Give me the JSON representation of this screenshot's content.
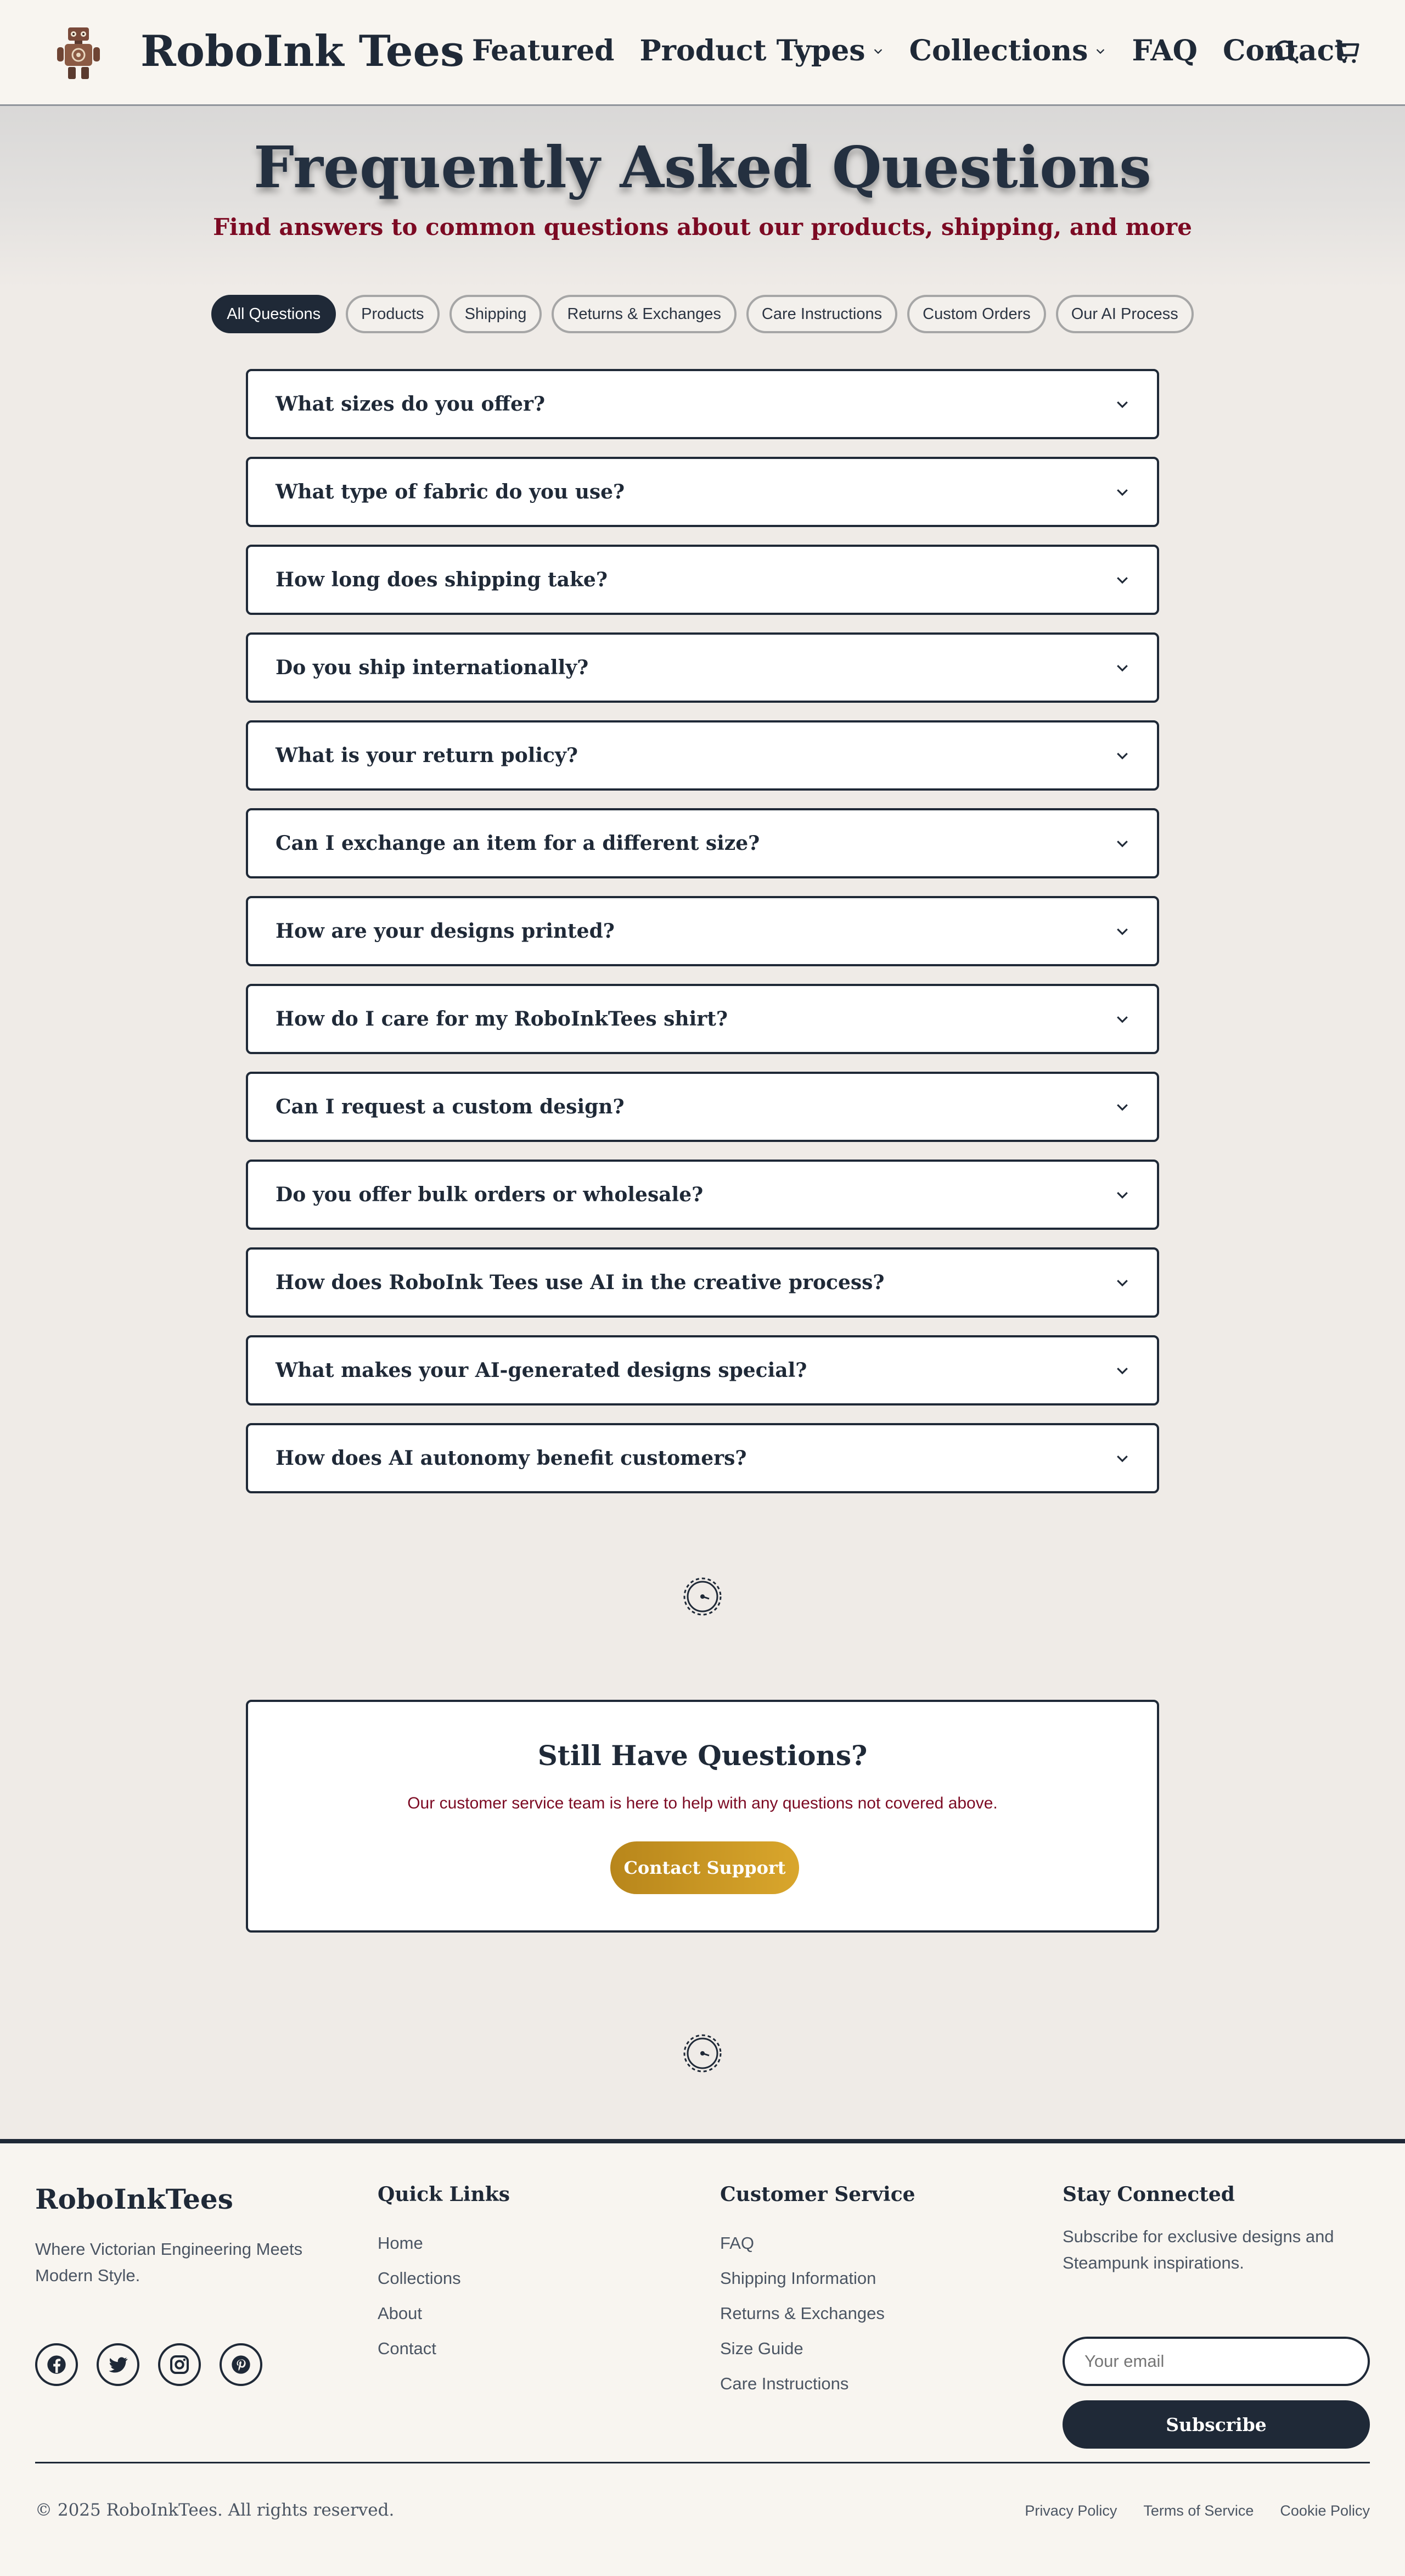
{
  "header": {
    "brand": "RoboInk Tees",
    "nav": [
      {
        "label": "Featured",
        "dropdown": false
      },
      {
        "label": "Product Types",
        "dropdown": true
      },
      {
        "label": "Collections",
        "dropdown": true
      },
      {
        "label": "FAQ",
        "dropdown": false
      },
      {
        "label": "Contact",
        "dropdown": false
      }
    ],
    "icons": [
      "search-icon",
      "cart-icon"
    ]
  },
  "hero": {
    "title": "Frequently Asked Questions",
    "subtitle": "Find answers to common questions about our products, shipping, and more"
  },
  "filters": [
    {
      "label": "All Questions",
      "active": true
    },
    {
      "label": "Products",
      "active": false
    },
    {
      "label": "Shipping",
      "active": false
    },
    {
      "label": "Returns & Exchanges",
      "active": false
    },
    {
      "label": "Care Instructions",
      "active": false
    },
    {
      "label": "Custom Orders",
      "active": false
    },
    {
      "label": "Our AI Process",
      "active": false
    }
  ],
  "faq": [
    "What sizes do you offer?",
    "What type of fabric do you use?",
    "How long does shipping take?",
    "Do you ship internationally?",
    "What is your return policy?",
    "Can I exchange an item for a different size?",
    "How are your designs printed?",
    "How do I care for my RoboInkTees shirt?",
    "Can I request a custom design?",
    "Do you offer bulk orders or wholesale?",
    "How does RoboInk Tees use AI in the creative process?",
    "What makes your AI-generated designs special?",
    "How does AI autonomy benefit customers?"
  ],
  "cta": {
    "title": "Still Have Questions?",
    "text": "Our customer service team is here to help with any questions not covered above.",
    "button": "Contact Support"
  },
  "footer": {
    "brand": "RoboInkTees",
    "tagline": "Where Victorian Engineering Meets Modern Style.",
    "socials": [
      "facebook-icon",
      "twitter-icon",
      "instagram-icon",
      "pinterest-icon"
    ],
    "quick_links": {
      "heading": "Quick Links",
      "links": [
        "Home",
        "Collections",
        "About",
        "Contact"
      ]
    },
    "customer_service": {
      "heading": "Customer Service",
      "links": [
        "FAQ",
        "Shipping Information",
        "Returns & Exchanges",
        "Size Guide",
        "Care Instructions"
      ]
    },
    "newsletter": {
      "heading": "Stay Connected",
      "text": "Subscribe for exclusive designs and Steampunk inspirations.",
      "placeholder": "Your email",
      "button": "Subscribe"
    },
    "copyright": "© 2025 RoboInkTees. All rights reserved.",
    "legal": [
      "Privacy Policy",
      "Terms of Service",
      "Cookie Policy"
    ]
  },
  "colors": {
    "primary": "#1f2937",
    "accent_red": "#7c0a23",
    "gold": "#c9961f",
    "background": "#efebe7",
    "header_bg": "#f8f5f0"
  }
}
